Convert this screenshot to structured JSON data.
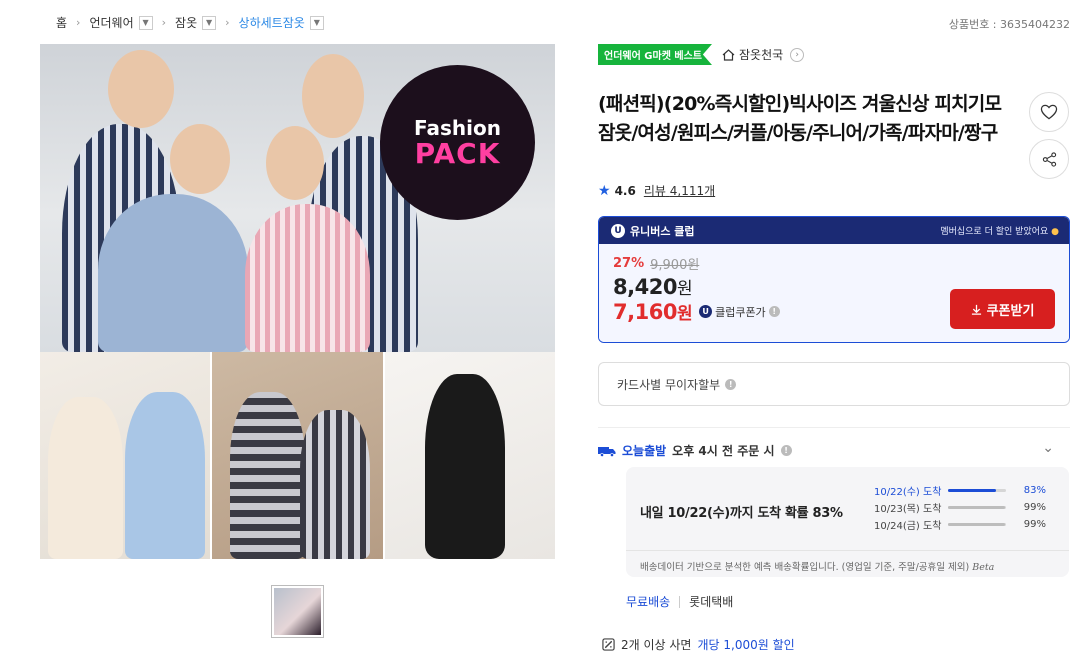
{
  "breadcrumb": {
    "home": "홈",
    "cat1": "언더웨어",
    "cat2": "잠옷",
    "cat3": "상하세트잠옷"
  },
  "product_number": "상품번호 : 3635404232",
  "gallery": {
    "brand_line1": "Fashion",
    "brand_line2": "PACK"
  },
  "badges": {
    "best": "언더웨어 G마켓 베스트",
    "store": "잠옷천국"
  },
  "title": "(패션픽)(20%즉시할인)빅사이즈 겨울신상 피치기모 잠옷/여성/원피스/커플/아동/주니어/가족/파자마/짱구",
  "rating": {
    "score": "4.6",
    "review_label": "리뷰",
    "review_count": "4,111개"
  },
  "club": {
    "name": "유니버스 클럽",
    "promo": "멤버십으로 더 할인 받았어요"
  },
  "price": {
    "discount": "27%",
    "original": "9,900원",
    "amount": "8,420",
    "unit": "원",
    "club_amount": "7,160",
    "club_unit": "원",
    "club_coupon_label": "클럽쿠폰가",
    "coupon_button": "쿠폰받기"
  },
  "card": {
    "label": "카드사별 무이자할부"
  },
  "delivery": {
    "today_label": "오늘출발",
    "text": "오후 4시 전 주문 시",
    "main": "내일 10/22(수)까지 도착 확률 83%",
    "rows": [
      {
        "date": "10/22(수) 도착",
        "pct": "83%",
        "value": 0.83
      },
      {
        "date": "10/23(목) 도착",
        "pct": "99%",
        "value": 0.99
      },
      {
        "date": "10/24(금) 도착",
        "pct": "99%",
        "value": 0.99
      }
    ],
    "note": "배송데이터 기반으로 분석한 예측 배송확률입니다. (영업일 기준, 주말/공휴일 제외)",
    "beta": "Beta"
  },
  "shipping": {
    "free": "무료배송",
    "courier": "롯데택배"
  },
  "bulk": {
    "prefix": "2개 이상 사면",
    "highlight": "개당 1,000원 할인"
  },
  "colors": {
    "accent_blue": "#1c4dd6",
    "club_navy": "#1b2a74",
    "price_red": "#e12d2d",
    "best_green": "#16b43c"
  }
}
